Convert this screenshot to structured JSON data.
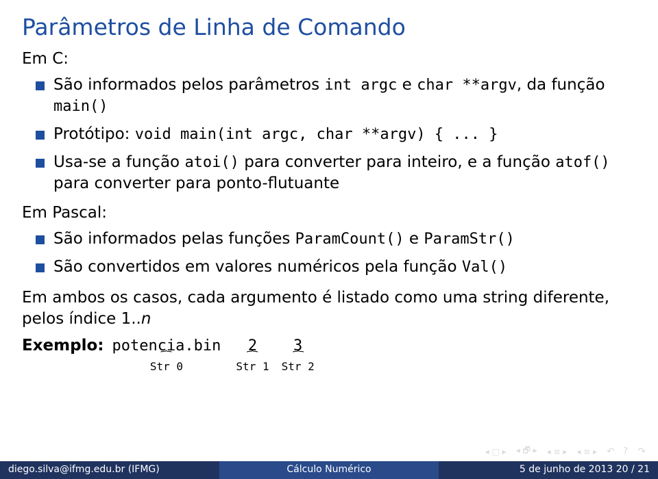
{
  "title": "Parâmetros de Linha de Comando",
  "sections": {
    "c": {
      "heading": "Em C:",
      "items": [
        {
          "pre": "São informados pelos parâmetros ",
          "code1": "int argc",
          "mid1": " e ",
          "code2": "char **argv",
          "mid2": ", da função ",
          "code3": "main()",
          "post": ""
        },
        {
          "pre": "Protótipo: ",
          "code1": "void main(int argc, char **argv) { ... }",
          "mid1": "",
          "code2": "",
          "mid2": "",
          "code3": "",
          "post": ""
        },
        {
          "pre": "Usa-se a função ",
          "code1": "atoi()",
          "mid1": " para converter para inteiro, e a função ",
          "code2": "atof()",
          "mid2": " para converter para ponto-flutuante",
          "code3": "",
          "post": ""
        }
      ]
    },
    "pascal": {
      "heading": "Em Pascal:",
      "items": [
        {
          "pre": "São informados pelas funções ",
          "code1": "ParamCount()",
          "mid1": " e ",
          "code2": "ParamStr()",
          "mid2": "",
          "code3": "",
          "post": ""
        },
        {
          "pre": "São convertidos em valores numéricos pela função ",
          "code1": "Val()",
          "mid1": "",
          "code2": "",
          "mid2": "",
          "code3": "",
          "post": ""
        }
      ]
    }
  },
  "closing": {
    "text_pre": "Em ambos os casos, cada argumento é listado como uma string diferente, pelos índice 1..",
    "italic": "n"
  },
  "example": {
    "label": "Exemplo:",
    "parts": [
      {
        "term": "potencia.bin",
        "label": "Str 0"
      },
      {
        "term": "2",
        "label": "Str 1"
      },
      {
        "term": "3",
        "label": "Str 2"
      }
    ]
  },
  "footer": {
    "left": "diego.silva@ifmg.edu.br (IFMG)",
    "mid": "Cálculo Numérico",
    "right": "5 de junho de 2013    20 / 21"
  }
}
